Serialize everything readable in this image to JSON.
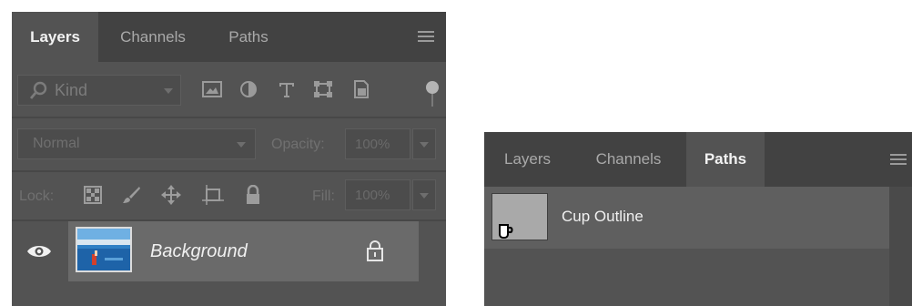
{
  "layers_panel": {
    "tabs": [
      {
        "label": "Layers",
        "active": true
      },
      {
        "label": "Channels",
        "active": false
      },
      {
        "label": "Paths",
        "active": false
      }
    ],
    "filter": {
      "kind_label": "Kind",
      "icons": [
        "image-filter-icon",
        "adjustment-filter-icon",
        "type-filter-icon",
        "shape-filter-icon",
        "smart-object-filter-icon",
        "filter-toggle-icon"
      ]
    },
    "blend_mode": "Normal",
    "opacity_label": "Opacity:",
    "opacity_value": "100%",
    "lock_label": "Lock:",
    "lock_icons": [
      "lock-transparent-pixels-icon",
      "lock-image-pixels-icon",
      "lock-position-icon",
      "lock-artboard-icon",
      "lock-all-icon"
    ],
    "fill_label": "Fill:",
    "fill_value": "100%",
    "layers": [
      {
        "name": "Background",
        "visible": true,
        "locked": true
      }
    ]
  },
  "paths_panel": {
    "tabs": [
      {
        "label": "Layers",
        "active": false
      },
      {
        "label": "Channels",
        "active": false
      },
      {
        "label": "Paths",
        "active": true
      }
    ],
    "paths": [
      {
        "name": "Cup Outline"
      }
    ]
  },
  "colors": {
    "panel_bg": "#535353",
    "tab_bar_bg": "#424242",
    "selected_row": "#6a6a6a"
  }
}
